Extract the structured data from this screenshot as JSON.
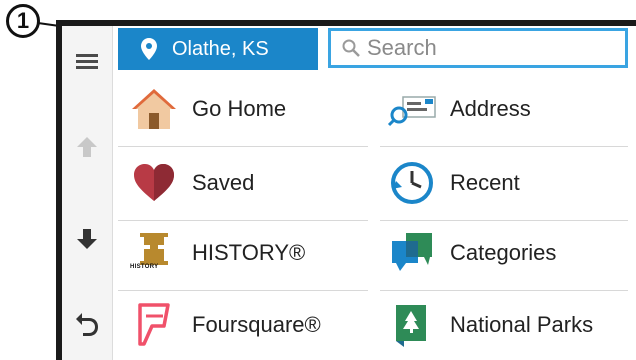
{
  "callout": {
    "number": "1"
  },
  "location": {
    "label": "Olathe, KS"
  },
  "search": {
    "placeholder": "Search"
  },
  "rail": {
    "menu_icon": "hamburger-icon",
    "up_icon": "arrow-up-icon",
    "down_icon": "arrow-down-icon",
    "back_icon": "back-icon"
  },
  "items": {
    "go_home": "Go Home",
    "address": "Address",
    "saved": "Saved",
    "recent": "Recent",
    "history": "HISTORY®",
    "categories": "Categories",
    "foursquare": "Foursquare®",
    "national_parks": "National Parks",
    "history_logo_text": "HISTORY"
  },
  "colors": {
    "accent": "#1b86c9",
    "search_border": "#3aa4e2",
    "heart": "#b83a45",
    "foursquare": "#f0516a"
  }
}
